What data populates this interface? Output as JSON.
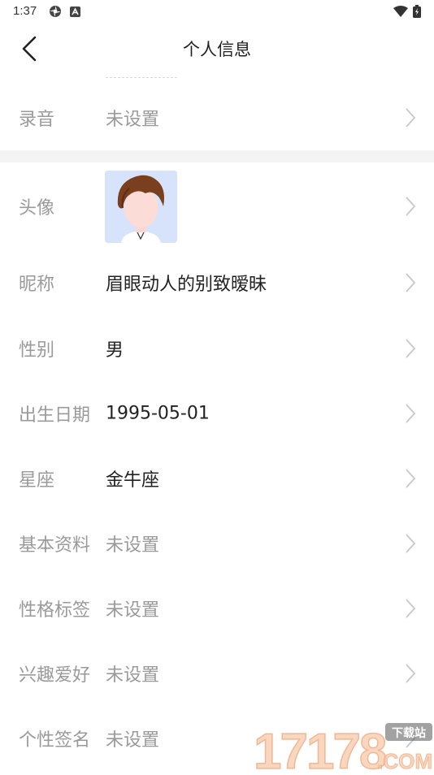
{
  "status_bar": {
    "time": "1:37"
  },
  "header": {
    "title": "个人信息"
  },
  "rows": [
    {
      "label": "录音",
      "value": "未设置",
      "unset": true
    },
    {
      "label": "头像"
    },
    {
      "label": "昵称",
      "value": "眉眼动人的别致暧昧",
      "unset": false
    },
    {
      "label": "性别",
      "value": "男",
      "unset": false
    },
    {
      "label": "出生日期",
      "value": "1995-05-01",
      "unset": false
    },
    {
      "label": "星座",
      "value": "金牛座",
      "unset": false
    },
    {
      "label": "基本资料",
      "value": "未设置",
      "unset": true
    },
    {
      "label": "性格标签",
      "value": "未设置",
      "unset": true
    },
    {
      "label": "兴趣爱好",
      "value": "未设置",
      "unset": true
    },
    {
      "label": "个性签名",
      "value": "未设置",
      "unset": true
    }
  ],
  "watermark": {
    "number": "17178",
    "badge": "下载站",
    "suffix": ".COM"
  },
  "colors": {
    "label": "#9a9a9a",
    "value": "#222222",
    "divider": "#f4f4f4",
    "avatar_bg": "#d6e3fb"
  }
}
